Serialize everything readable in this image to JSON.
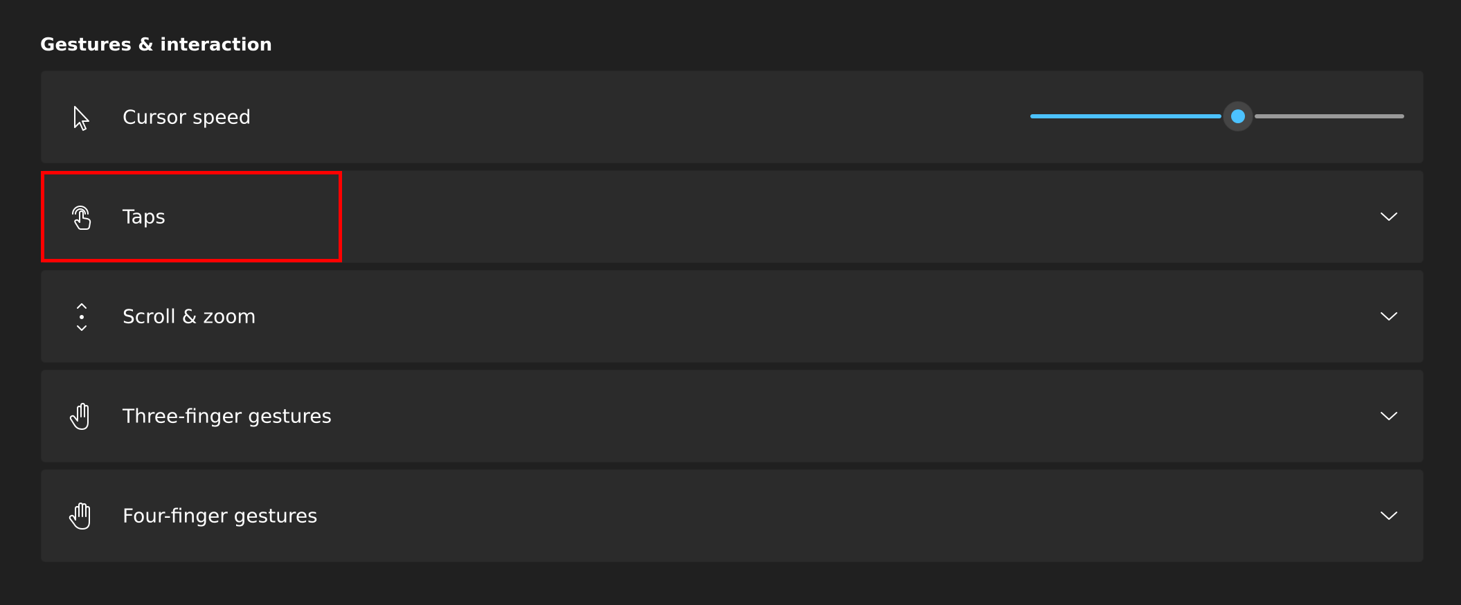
{
  "section": {
    "title": "Gestures & interaction"
  },
  "cursor_speed": {
    "label": "Cursor speed",
    "icon": "cursor-arrow-icon",
    "slider_level": 0.555,
    "accent_color": "#4cc2ff"
  },
  "items": [
    {
      "label": "Taps",
      "icon": "tap-hand-icon"
    },
    {
      "label": "Scroll & zoom",
      "icon": "scroll-zoom-icon"
    },
    {
      "label": "Three-finger gestures",
      "icon": "three-finger-hand-icon"
    },
    {
      "label": "Four-finger gestures",
      "icon": "four-finger-hand-icon"
    }
  ],
  "highlight_color": "#ff0000"
}
